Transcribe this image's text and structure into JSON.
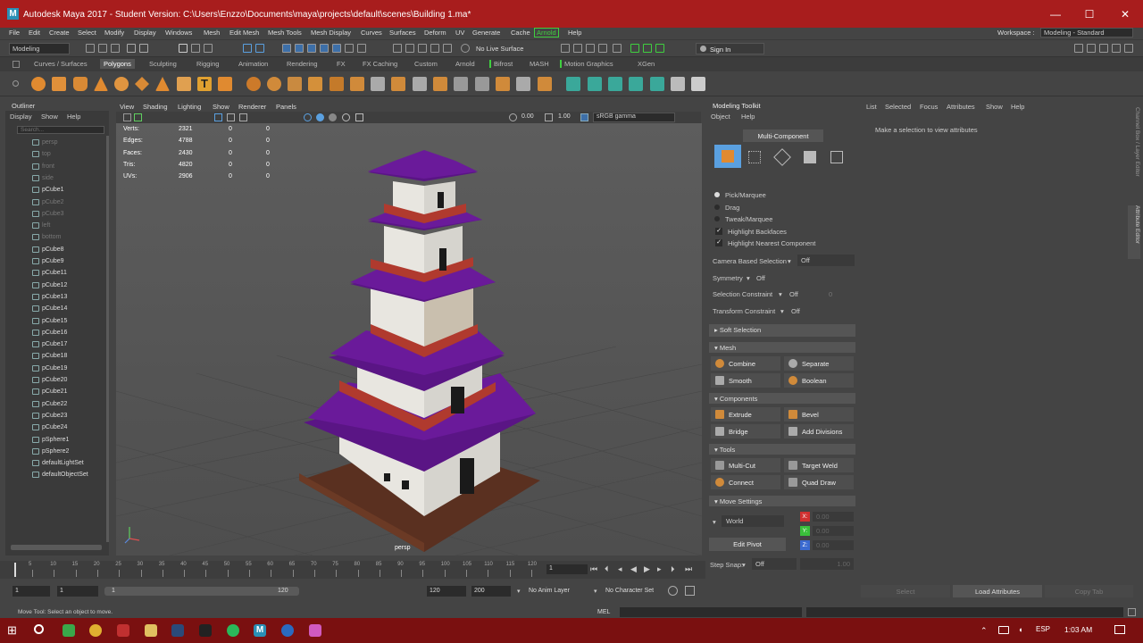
{
  "window": {
    "title": "Autodesk Maya 2017 - Student Version: C:\\Users\\Enzzo\\Documents\\maya\\projects\\default\\scenes\\Building 1.ma*",
    "logo": "M",
    "minimize_glyph": "—",
    "maximize_glyph": "☐",
    "close_glyph": "✕"
  },
  "menus": [
    "File",
    "Edit",
    "Create",
    "Select",
    "Modify",
    "Display",
    "Windows",
    "Mesh",
    "Edit Mesh",
    "Mesh Tools",
    "Mesh Display",
    "Curves",
    "Surfaces",
    "Deform",
    "UV",
    "Generate",
    "Cache",
    "Arnold",
    "Help"
  ],
  "workspace": {
    "label": "Workspace :",
    "value": "Modeling - Standard"
  },
  "statusline": {
    "mode": "Modeling",
    "live_surface": "No Live Surface",
    "sign_in": "Sign In"
  },
  "shelf_tabs": [
    "Curves / Surfaces",
    "Polygons",
    "Sculpting",
    "Rigging",
    "Animation",
    "Rendering",
    "FX",
    "FX Caching",
    "Custom",
    "Arnold",
    "Bifrost",
    "MASH",
    "Motion Graphics",
    "XGen"
  ],
  "shelf_active": "Polygons",
  "outliner": {
    "title": "Outliner",
    "menu": [
      "Display",
      "Show",
      "Help"
    ],
    "search_placeholder": "Search...",
    "items": [
      {
        "label": "persp",
        "dim": true
      },
      {
        "label": "top",
        "dim": true
      },
      {
        "label": "front",
        "dim": true
      },
      {
        "label": "side",
        "dim": true
      },
      {
        "label": "pCube1",
        "dim": false
      },
      {
        "label": "pCube2",
        "dim": true
      },
      {
        "label": "pCube3",
        "dim": true
      },
      {
        "label": "left",
        "dim": true
      },
      {
        "label": "bottom",
        "dim": true
      },
      {
        "label": "pCube8",
        "dim": false
      },
      {
        "label": "pCube9",
        "dim": false
      },
      {
        "label": "pCube11",
        "dim": false
      },
      {
        "label": "pCube12",
        "dim": false
      },
      {
        "label": "pCube13",
        "dim": false
      },
      {
        "label": "pCube14",
        "dim": false
      },
      {
        "label": "pCube15",
        "dim": false
      },
      {
        "label": "pCube16",
        "dim": false
      },
      {
        "label": "pCube17",
        "dim": false
      },
      {
        "label": "pCube18",
        "dim": false
      },
      {
        "label": "pCube19",
        "dim": false
      },
      {
        "label": "pCube20",
        "dim": false
      },
      {
        "label": "pCube21",
        "dim": false
      },
      {
        "label": "pCube22",
        "dim": false
      },
      {
        "label": "pCube23",
        "dim": false
      },
      {
        "label": "pCube24",
        "dim": false
      },
      {
        "label": "pSphere1",
        "dim": false
      },
      {
        "label": "pSphere2",
        "dim": false
      },
      {
        "label": "defaultLightSet",
        "dim": false
      },
      {
        "label": "defaultObjectSet",
        "dim": false
      }
    ]
  },
  "viewport": {
    "menu": [
      "View",
      "Shading",
      "Lighting",
      "Show",
      "Renderer",
      "Panels"
    ],
    "exposure": "0.00",
    "gamma": "1.00",
    "color_space": "sRGB gamma",
    "camera_label": "persp",
    "hud": [
      {
        "label": "Verts:",
        "v1": "2321",
        "v2": "0",
        "v3": "0"
      },
      {
        "label": "Edges:",
        "v1": "4788",
        "v2": "0",
        "v3": "0"
      },
      {
        "label": "Faces:",
        "v1": "2430",
        "v2": "0",
        "v3": "0"
      },
      {
        "label": "Tris:",
        "v1": "4820",
        "v2": "0",
        "v3": "0"
      },
      {
        "label": "UVs:",
        "v1": "2906",
        "v2": "0",
        "v3": "0"
      }
    ]
  },
  "toolkit": {
    "title": "Modeling Toolkit",
    "menu": [
      "Object",
      "Help"
    ],
    "multi_component": "Multi-Component",
    "pick_marquee": "Pick/Marquee",
    "drag": "Drag",
    "tweak_marquee": "Tweak/Marquee",
    "highlight_backfaces": "Highlight Backfaces",
    "highlight_nearest": "Highlight Nearest Component",
    "camera_based_selection": {
      "label": "Camera Based Selection",
      "value": "Off"
    },
    "symmetry": {
      "label": "Symmetry",
      "value": "Off"
    },
    "selection_constraint": {
      "label": "Selection Constraint",
      "value": "Off",
      "num": "0"
    },
    "transform_constraint": {
      "label": "Transform Constraint",
      "value": "Off"
    },
    "soft_selection": "Soft Selection",
    "mesh_header": "Mesh",
    "combine": "Combine",
    "separate": "Separate",
    "smooth": "Smooth",
    "boolean": "Boolean",
    "components_header": "Components",
    "extrude": "Extrude",
    "bevel": "Bevel",
    "bridge": "Bridge",
    "add_divisions": "Add Divisions",
    "tools_header": "Tools",
    "multi_cut": "Multi-Cut",
    "target_weld": "Target Weld",
    "connect": "Connect",
    "quad_draw": "Quad Draw",
    "move_settings": "Move Settings",
    "world": "World",
    "x_label": "X:",
    "y_label": "Y:",
    "z_label": "Z:",
    "x_val": "0.00",
    "y_val": "0.00",
    "z_val": "0.00",
    "edit_pivot": "Edit Pivot",
    "step_snap": {
      "label": "Step Snap:",
      "value": "Off",
      "num": "1.00"
    }
  },
  "attributes": {
    "menu": [
      "List",
      "Selected",
      "Focus",
      "Attributes",
      "Show",
      "Help"
    ],
    "message": "Make a selection to view attributes",
    "select": "Select",
    "load_attributes": "Load Attributes",
    "copy_tab": "Copy Tab",
    "side_tab1": "Channel Box / Layer Editor",
    "side_tab2": "Attribute Editor"
  },
  "timeline": {
    "ticks": [
      "5",
      "10",
      "15",
      "20",
      "25",
      "30",
      "35",
      "40",
      "45",
      "50",
      "55",
      "60",
      "65",
      "70",
      "75",
      "80",
      "85",
      "90",
      "95",
      "100",
      "105",
      "110",
      "115",
      "120"
    ],
    "current_frame": "1",
    "range_start": "1",
    "range_inner_start": "1",
    "slider_start": "1",
    "slider_end": "120",
    "range_end_inner": "120",
    "range_end": "200",
    "anim_layer": "No Anim Layer",
    "character_set": "No Character Set"
  },
  "help_line": "Move Tool: Select an object to move.",
  "mel_label": "MEL",
  "taskbar": {
    "lang": "ESP",
    "time": "1:03 AM"
  },
  "colors": {
    "titlebar": "#a81d1d",
    "taskbar": "#7a1010",
    "roof": "#6a1a9a",
    "walls": "#e8e6e0",
    "railing": "#b03a2e",
    "base": "#6b3a25"
  }
}
